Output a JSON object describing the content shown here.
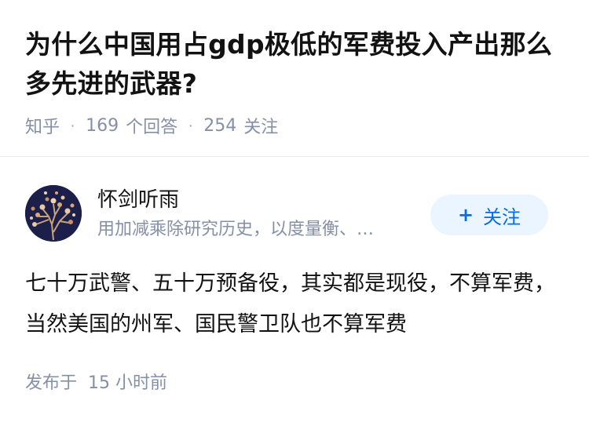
{
  "question": {
    "title": "为什么中国用占gdp极低的军费投入产出那么多先进的武器?",
    "source": "知乎",
    "answer_count": "169",
    "answer_label": "个回答",
    "follower_count": "254",
    "follower_label": "关注"
  },
  "author": {
    "name": "怀剑听雨",
    "headline": "用加减乘除研究历史，以度量衡、…",
    "follow_label": "关注",
    "follow_icon": "plus-icon"
  },
  "answer": {
    "text": "七十万武警、五十万预备役，其实都是现役，不算军费，当然美国的州军、国民警卫队也不算军费",
    "published_prefix": "发布于",
    "published_time": "15 小时前"
  },
  "colors": {
    "primary_text": "#121212",
    "secondary_text": "#8590a6",
    "accent": "#056de8",
    "follow_bg": "#ebf5ff",
    "avatar_bg": "#1c1f4a",
    "divider": "#ebebeb"
  }
}
